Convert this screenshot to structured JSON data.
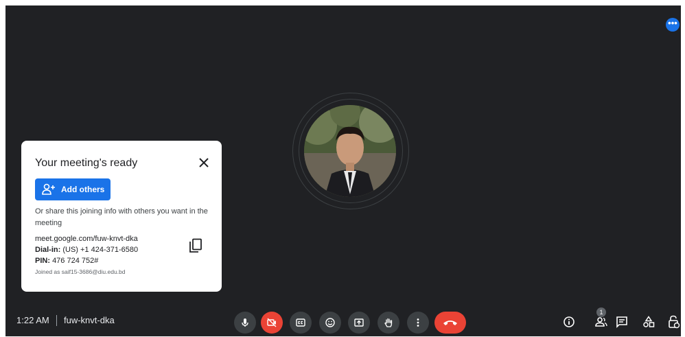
{
  "meeting": {
    "time": "1:22 AM",
    "code": "fuw-knvt-dka"
  },
  "card": {
    "title": "Your meeting's ready",
    "add_label": "Add others",
    "share_text": "Or share this joining info with others you want in the meeting",
    "link": "meet.google.com/fuw-knvt-dka",
    "dialin_label": "Dial-in:",
    "dialin_value": "(US) +1 424-371-6580",
    "pin_label": "PIN:",
    "pin_value": "476 724 752#",
    "joined": "Joined as saif15-3686@diu.edu.bd"
  },
  "participants": {
    "count": "1"
  },
  "top": {
    "more_label": "•••"
  },
  "colors": {
    "background": "#202124",
    "accent": "#1a73e8",
    "end_call": "#ea4335"
  },
  "icons": [
    "more-options-icon",
    "close-icon",
    "add-person-icon",
    "copy-icon",
    "mic-icon",
    "camera-off-icon",
    "captions-icon",
    "emoji-icon",
    "present-icon",
    "raise-hand-icon",
    "more-vert-icon",
    "end-call-icon",
    "info-icon",
    "people-icon",
    "chat-icon",
    "activities-icon",
    "host-controls-icon"
  ]
}
